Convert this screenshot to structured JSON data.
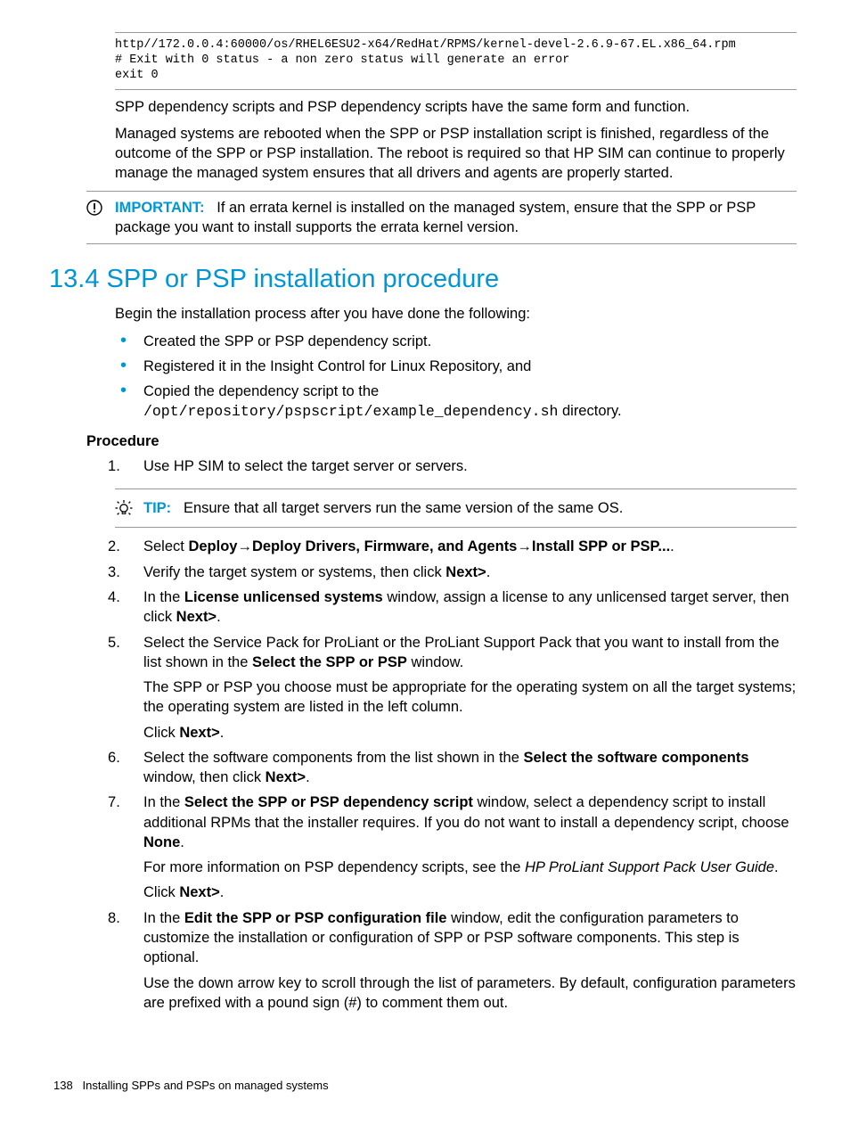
{
  "codeblock": "http//172.0.0.4:60000/os/RHEL6ESU2-x64/RedHat/RPMS/kernel-devel-2.6.9-67.EL.x86_64.rpm\n# Exit with 0 status - a non zero status will generate an error\nexit 0",
  "para1": "SPP dependency scripts and PSP dependency scripts have the same form and function.",
  "para2": "Managed systems are rebooted when the SPP or PSP installation script is finished, regardless of the outcome of the SPP or PSP installation. The reboot is required so that HP SIM can continue to properly manage the managed system ensures that all drivers and agents are properly started.",
  "important_label": "IMPORTANT:",
  "important_text": "If an errata kernel is installed on the managed system, ensure that the SPP or PSP package you want to install supports the errata kernel version.",
  "section_title": "13.4 SPP or PSP installation procedure",
  "intro": "Begin the installation process after you have done the following:",
  "bullets": {
    "0": "Created the SPP or PSP dependency script.",
    "1": "Registered it in the Insight Control for Linux Repository, and",
    "2_pre": "Copied the dependency script to the ",
    "2_code": "/opt/repository/pspscript/example_dependency.sh",
    "2_post": " directory."
  },
  "procedure_heading": "Procedure",
  "step1": "Use HP SIM to select the target server or servers.",
  "tip_label": "TIP:",
  "tip_text": "Ensure that all target servers run the same version of the same OS.",
  "step2": {
    "pre": "Select ",
    "b1": "Deploy",
    "arrow1": "→",
    "b2": "Deploy Drivers, Firmware, and Agents",
    "arrow2": "→",
    "b3": "Install SPP or PSP...",
    "post": "."
  },
  "step3": {
    "pre": "Verify the target system or systems, then click ",
    "b": "Next>",
    "post": "."
  },
  "step4": {
    "pre": "In the ",
    "b1": "License unlicensed systems",
    "mid": " window, assign a license to any unlicensed target server, then click ",
    "b2": "Next>",
    "post": "."
  },
  "step5": {
    "p1_pre": "Select the Service Pack for ProLiant or the ProLiant Support Pack that you want to install from the list shown in the ",
    "p1_b": "Select the SPP or PSP",
    "p1_post": " window.",
    "p2": "The SPP or PSP you choose must be appropriate for the operating system on all the target systems; the operating system are listed in the left column.",
    "p3_pre": "Click ",
    "p3_b": "Next>",
    "p3_post": "."
  },
  "step6": {
    "pre": "Select the software components from the list shown in the ",
    "b1": "Select the software components",
    "mid": " window, then click ",
    "b2": "Next>",
    "post": "."
  },
  "step7": {
    "p1_pre": "In the ",
    "p1_b1": "Select the SPP or PSP dependency script",
    "p1_mid": " window, select a dependency script to install additional RPMs that the installer requires. If you do not want to install a dependency script, choose ",
    "p1_b2": "None",
    "p1_post": ".",
    "p2_pre": "For more information on PSP dependency scripts, see the ",
    "p2_i": "HP ProLiant Support Pack User Guide",
    "p2_post": ".",
    "p3_pre": "Click ",
    "p3_b": "Next>",
    "p3_post": "."
  },
  "step8": {
    "p1_pre": "In the ",
    "p1_b": "Edit the SPP or PSP configuration file",
    "p1_post": " window, edit the configuration parameters to customize the installation or configuration of SPP or PSP software components. This step is optional.",
    "p2": "Use the down arrow key to scroll through the list of parameters. By default, configuration parameters are prefixed with a pound sign (#) to comment them out."
  },
  "footer": {
    "page": "138",
    "title": "Installing SPPs and PSPs on managed systems"
  }
}
